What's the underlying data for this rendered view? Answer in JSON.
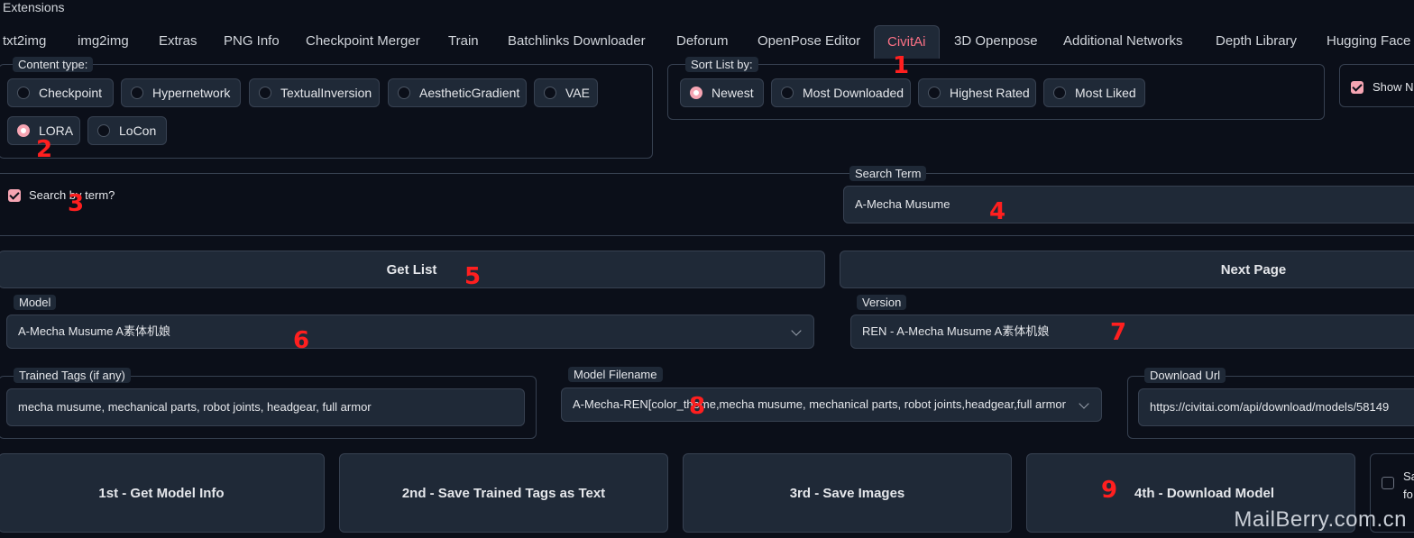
{
  "header": {
    "title": "Extensions"
  },
  "tabs": [
    {
      "label": "txt2img"
    },
    {
      "label": "img2img"
    },
    {
      "label": "Extras"
    },
    {
      "label": "PNG Info"
    },
    {
      "label": "Checkpoint Merger"
    },
    {
      "label": "Train"
    },
    {
      "label": "Batchlinks Downloader"
    },
    {
      "label": "Deforum"
    },
    {
      "label": "OpenPose Editor"
    },
    {
      "label": "CivitAi"
    },
    {
      "label": "3D Openpose"
    },
    {
      "label": "Additional Networks"
    },
    {
      "label": "Depth Library"
    },
    {
      "label": "Hugging Face"
    }
  ],
  "content_type": {
    "label": "Content type:",
    "options": [
      "Checkpoint",
      "Hypernetwork",
      "TextualInversion",
      "AestheticGradient",
      "VAE",
      "LORA",
      "LoCon"
    ],
    "selected": "LORA"
  },
  "sort": {
    "label": "Sort List by:",
    "options": [
      "Newest",
      "Most Downloaded",
      "Highest Rated",
      "Most Liked"
    ],
    "selected": "Newest"
  },
  "show_nsfw": {
    "label": "Show N",
    "checked": true
  },
  "search_checkbox": {
    "label": "Search by term?",
    "checked": true
  },
  "search_term": {
    "label": "Search Term",
    "value": "A-Mecha Musume"
  },
  "buttons": {
    "get_list": "Get List",
    "next_page": "Next Page"
  },
  "model": {
    "label": "Model",
    "value": "A-Mecha Musume A素体机娘"
  },
  "version": {
    "label": "Version",
    "value": "REN - A-Mecha Musume A素体机娘"
  },
  "trained_tags": {
    "label": "Trained Tags (if any)",
    "value": "mecha musume, mechanical parts, robot joints, headgear, full armor"
  },
  "model_filename": {
    "label": "Model Filename",
    "value": "A-Mecha-REN[color_theme,mecha musume, mechanical parts, robot joints,headgear,full armor"
  },
  "download_url": {
    "label": "Download Url",
    "value": "https://civitai.com/api/download/models/58149"
  },
  "actions": {
    "get_info": "1st - Get Model Info",
    "save_tags": "2nd - Save Trained Tags as Text",
    "save_images": "3rd - Save Images",
    "download": "4th - Download Model"
  },
  "save_folder": {
    "label": "Sa fo",
    "line1": "Sa",
    "line2": "fo",
    "checked": false
  },
  "annotations": [
    "1",
    "2",
    "3",
    "4",
    "5",
    "6",
    "7",
    "8",
    "9"
  ],
  "watermark": "MailBerry.com.cn",
  "colors": {
    "accent": "#f6a5b3",
    "active_tab": "#fb7185",
    "annotation": "#ff1f1f",
    "background": "#0b0f19",
    "panel": "#1f2937"
  }
}
